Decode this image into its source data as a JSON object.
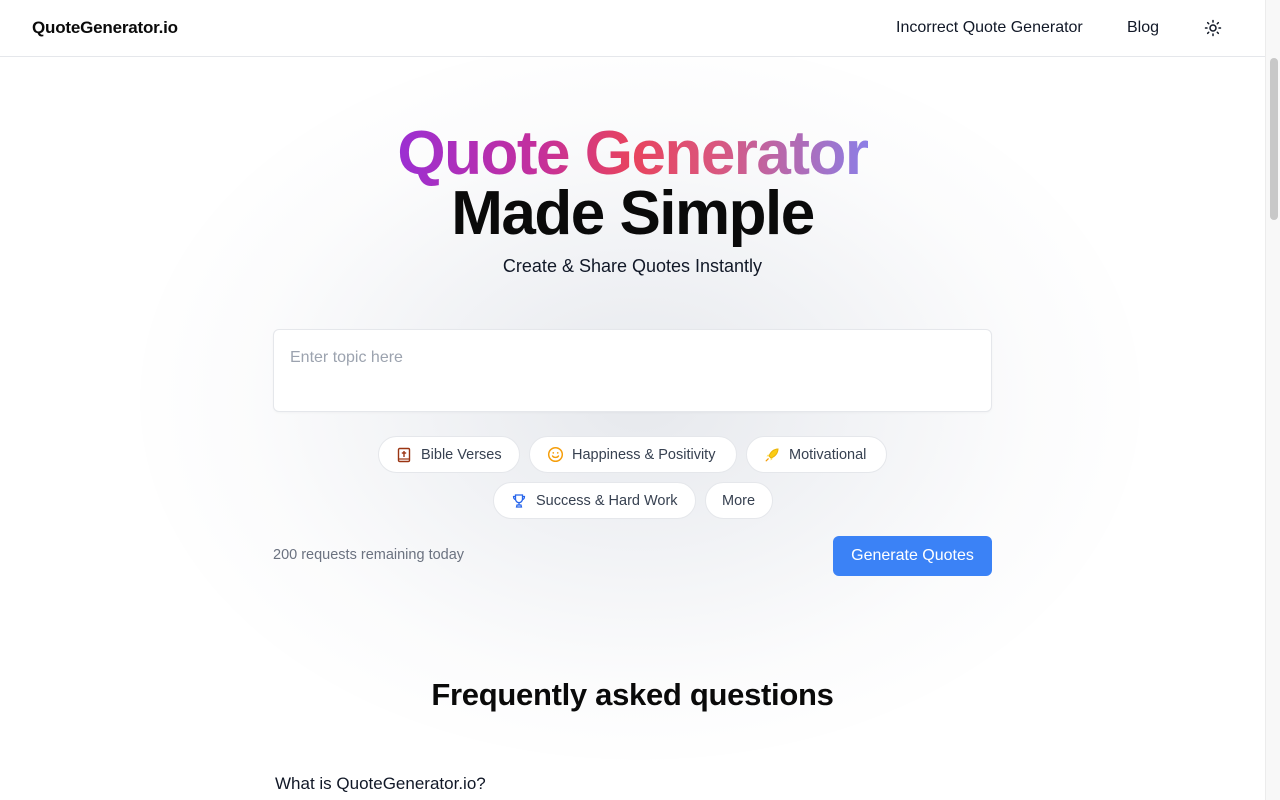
{
  "header": {
    "logo": "QuoteGenerator.io",
    "nav": {
      "incorrect_quote_generator": "Incorrect Quote Generator",
      "blog": "Blog"
    },
    "theme_toggle_icon": "sun-icon"
  },
  "hero": {
    "title_gradient": "Quote Generator",
    "title_plain": "Made Simple",
    "subtitle": "Create & Share Quotes Instantly",
    "gradient_colors": [
      "#9b2fd3",
      "#e8445e",
      "#8c7ee6"
    ]
  },
  "topic_input": {
    "placeholder": "Enter topic here",
    "value": ""
  },
  "chips": [
    {
      "label": "Bible Verses",
      "icon": "bible-icon",
      "icon_color": "#b45309"
    },
    {
      "label": "Happiness & Positivity",
      "icon": "smiley-icon",
      "icon_color": "#f59e0b"
    },
    {
      "label": "Motivational",
      "icon": "rocket-icon",
      "icon_color": "#eab308"
    },
    {
      "label": "Success & Hard Work",
      "icon": "trophy-icon",
      "icon_color": "#3b82f6"
    },
    {
      "label": "More",
      "icon": "",
      "icon_color": ""
    }
  ],
  "usage": {
    "remaining_text": "200 requests remaining today"
  },
  "generate_button": {
    "label": "Generate Quotes",
    "color": "#3b82f6"
  },
  "faq": {
    "title": "Frequently asked questions",
    "questions": [
      {
        "q": "What is QuoteGenerator.io?"
      }
    ]
  }
}
